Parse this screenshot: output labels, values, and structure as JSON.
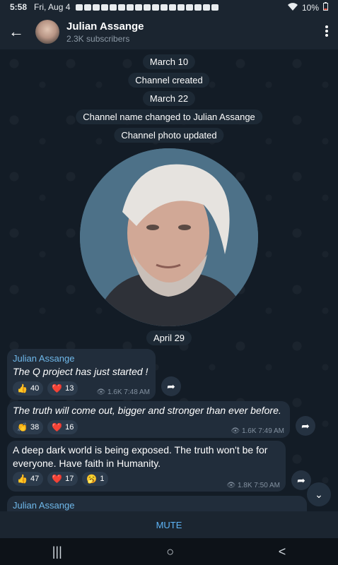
{
  "status_bar": {
    "time": "5:58",
    "date": "Fri, Aug 4",
    "battery": "10%"
  },
  "header": {
    "title": "Julian Assange",
    "subtitle": "2.3K subscribers"
  },
  "services": [
    "March 10",
    "Channel created",
    "March 22",
    "Channel name changed to Julian Assange",
    "Channel photo updated",
    "April 29"
  ],
  "messages": [
    {
      "author": "Julian Assange",
      "text": "The Q project has just started !",
      "reactions": [
        {
          "emoji": "👍",
          "count": "40"
        },
        {
          "emoji": "❤️",
          "count": "13"
        }
      ],
      "views": "1.6K",
      "time": "7:48 AM"
    },
    {
      "text": "The truth will come out, bigger and stronger than ever before.",
      "reactions": [
        {
          "emoji": "👏",
          "count": "38"
        },
        {
          "emoji": "❤️",
          "count": "16"
        }
      ],
      "views": "1.6K",
      "time": "7:49 AM"
    },
    {
      "text": "A deep dark world is being exposed. The truth won't be for everyone. Have faith in Humanity.",
      "reactions": [
        {
          "emoji": "👍",
          "count": "47"
        },
        {
          "emoji": "❤️",
          "count": "17"
        },
        {
          "emoji": "🥱",
          "count": "1"
        }
      ],
      "views": "1.8K",
      "time": "7:50 AM"
    },
    {
      "author": "Julian Assange"
    }
  ],
  "mute_label": "MUTE",
  "icons": {
    "back": "←",
    "menu": "⋮",
    "forward": "➦",
    "scroll_down": "⌄",
    "nav_recents": "|||",
    "nav_home": "○",
    "nav_back": "<",
    "views": "👁"
  },
  "colors": {
    "accent": "#5eb5f7",
    "bubble": "#212d3b",
    "background": "#131c26"
  }
}
